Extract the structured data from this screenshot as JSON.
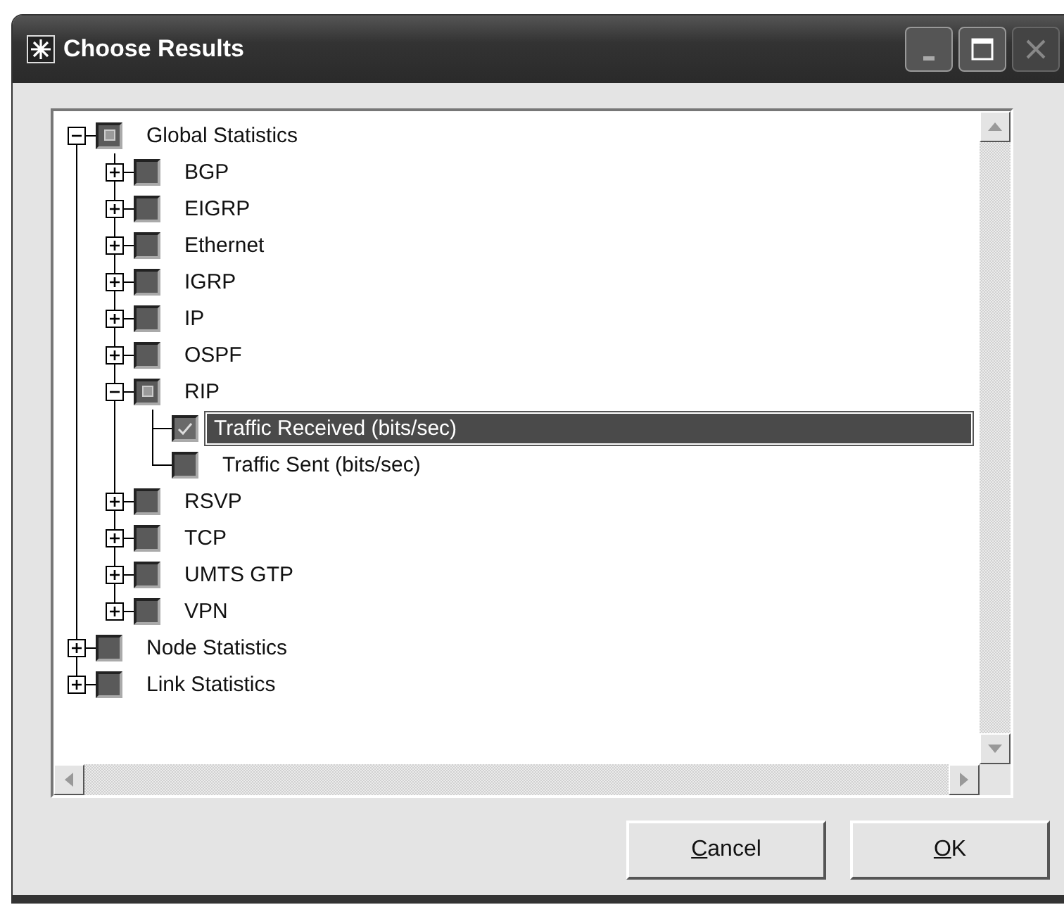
{
  "window": {
    "title": "Choose Results"
  },
  "tree": {
    "items": [
      {
        "label": "Global Statistics",
        "kind": "group",
        "expanded": true,
        "checked": false,
        "partial": true,
        "selected": false,
        "children": [
          {
            "label": "BGP",
            "kind": "group",
            "expanded": false,
            "checked": false,
            "partial": false,
            "selected": false
          },
          {
            "label": "EIGRP",
            "kind": "group",
            "expanded": false,
            "checked": false,
            "partial": false,
            "selected": false
          },
          {
            "label": "Ethernet",
            "kind": "group",
            "expanded": false,
            "checked": false,
            "partial": false,
            "selected": false
          },
          {
            "label": "IGRP",
            "kind": "group",
            "expanded": false,
            "checked": false,
            "partial": false,
            "selected": false
          },
          {
            "label": "IP",
            "kind": "group",
            "expanded": false,
            "checked": false,
            "partial": false,
            "selected": false
          },
          {
            "label": "OSPF",
            "kind": "group",
            "expanded": false,
            "checked": false,
            "partial": false,
            "selected": false
          },
          {
            "label": "RIP",
            "kind": "group",
            "expanded": true,
            "checked": false,
            "partial": true,
            "selected": false,
            "children": [
              {
                "label": "Traffic Received (bits/sec)",
                "kind": "statistic",
                "checked": true,
                "partial": false,
                "selected": true
              },
              {
                "label": "Traffic Sent (bits/sec)",
                "kind": "statistic",
                "checked": false,
                "partial": false,
                "selected": false
              }
            ]
          },
          {
            "label": "RSVP",
            "kind": "group",
            "expanded": false,
            "checked": false,
            "partial": false,
            "selected": false
          },
          {
            "label": "TCP",
            "kind": "group",
            "expanded": false,
            "checked": false,
            "partial": false,
            "selected": false
          },
          {
            "label": "UMTS GTP",
            "kind": "group",
            "expanded": false,
            "checked": false,
            "partial": false,
            "selected": false
          },
          {
            "label": "VPN",
            "kind": "group",
            "expanded": false,
            "checked": false,
            "partial": false,
            "selected": false
          }
        ]
      },
      {
        "label": "Node Statistics",
        "kind": "group",
        "expanded": false,
        "checked": false,
        "partial": false,
        "selected": false
      },
      {
        "label": "Link Statistics",
        "kind": "group",
        "expanded": false,
        "checked": false,
        "partial": false,
        "selected": false
      }
    ]
  },
  "buttons": [
    {
      "label": "Cancel"
    },
    {
      "label": "OK"
    }
  ]
}
